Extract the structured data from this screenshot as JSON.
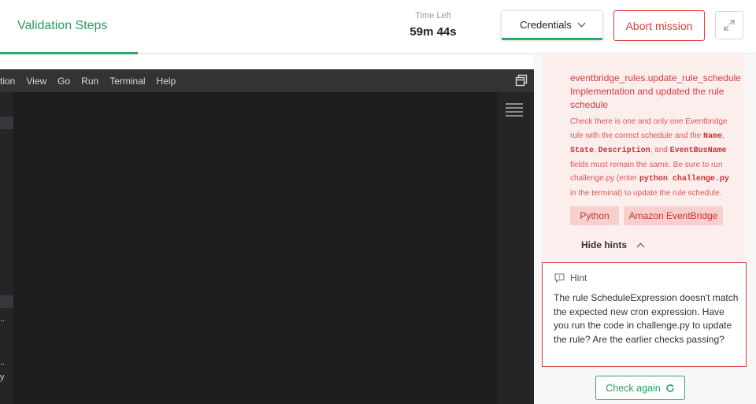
{
  "header": {
    "title": "Validation Steps",
    "timer_label": "Time Left",
    "timer_value": "59m 44s",
    "credentials_label": "Credentials",
    "abort_label": "Abort mission"
  },
  "editor": {
    "menu": [
      "ction",
      "View",
      "Go",
      "Run",
      "Terminal",
      "Help"
    ],
    "sidebar_fragments": [
      "..",
      "..",
      "y"
    ]
  },
  "panel": {
    "check_title": "eventbridge_rules.update_rule_schedule Implementation and updated the rule schedule",
    "check_desc": {
      "t1": "Check there is one and only one Eventbridge rule with the correct schedule and the ",
      "c1": "Name",
      "t2": ", ",
      "c2": "State",
      "t3": ", ",
      "c3": "Description",
      "t4": ", and ",
      "c4": "EventBusName",
      "t5": " fields must remain the same. Be sure to run challenge.py (enter ",
      "c5": "python challenge.py",
      "t6": " in the terminal) to update the rule schedule."
    },
    "tags": [
      "Python",
      "Amazon EventBridge"
    ],
    "hide_hints_label": "Hide hints",
    "hint_label": "Hint",
    "hint_text": "The rule ScheduleExpression doesn't match the expected new cron expression. Have you run the code in challenge.py to update the rule? Are the earlier checks passing?",
    "check_again_label": "Check again"
  },
  "colors": {
    "accent_green": "#2fa866",
    "error_red": "#d93939",
    "editor_bg": "#1e1e1e"
  },
  "icons": [
    "chevron-down-icon",
    "expand-icon",
    "layout-icon",
    "minimap-icon",
    "chevron-up-icon",
    "hint-icon",
    "refresh-icon"
  ]
}
